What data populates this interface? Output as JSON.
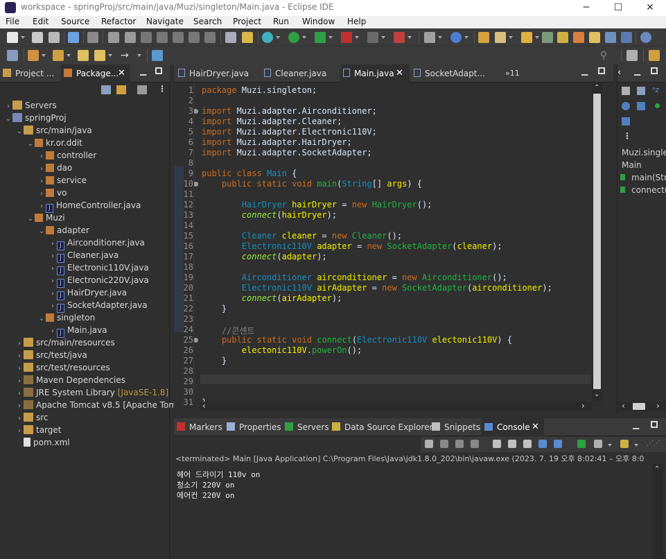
{
  "window": {
    "title": "workspace - springProj/src/main/java/Muzi/singleton/Main.java - Eclipse IDE"
  },
  "menu": [
    "File",
    "Edit",
    "Source",
    "Refactor",
    "Navigate",
    "Search",
    "Project",
    "Run",
    "Window",
    "Help"
  ],
  "left_tabs": {
    "project_explorer": "Project ...",
    "package_explorer": "Package..."
  },
  "tree": [
    {
      "label": "Servers",
      "level": 0,
      "type": "folder"
    },
    {
      "label": "springProj",
      "level": 0,
      "type": "proj"
    },
    {
      "label": "src/main/java",
      "level": 1,
      "type": "folder"
    },
    {
      "label": "kr.or.ddit",
      "level": 2,
      "type": "pkg"
    },
    {
      "label": "controller",
      "level": 3,
      "type": "pkg"
    },
    {
      "label": "dao",
      "level": 3,
      "type": "pkg"
    },
    {
      "label": "service",
      "level": 3,
      "type": "pkg"
    },
    {
      "label": "vo",
      "level": 3,
      "type": "pkg"
    },
    {
      "label": "HomeController.java",
      "level": 3,
      "type": "java"
    },
    {
      "label": "Muzi",
      "level": 2,
      "type": "pkg"
    },
    {
      "label": "adapter",
      "level": 3,
      "type": "pkg"
    },
    {
      "label": "Airconditioner.java",
      "level": 4,
      "type": "java"
    },
    {
      "label": "Cleaner.java",
      "level": 4,
      "type": "java"
    },
    {
      "label": "Electronic110V.java",
      "level": 4,
      "type": "java"
    },
    {
      "label": "Electronic220V.java",
      "level": 4,
      "type": "java"
    },
    {
      "label": "HairDryer.java",
      "level": 4,
      "type": "java"
    },
    {
      "label": "SocketAdapter.java",
      "level": 4,
      "type": "java"
    },
    {
      "label": "singleton",
      "level": 3,
      "type": "pkg"
    },
    {
      "label": "Main.java",
      "level": 4,
      "type": "java"
    },
    {
      "label": "src/main/resources",
      "level": 1,
      "type": "folder"
    },
    {
      "label": "src/test/java",
      "level": 1,
      "type": "folder"
    },
    {
      "label": "src/test/resources",
      "level": 1,
      "type": "folder"
    },
    {
      "label": "Maven Dependencies",
      "level": 1,
      "type": "lib"
    },
    {
      "label": "JRE System Library",
      "level": 1,
      "type": "lib",
      "suffix": "[JavaSE-1.8]"
    },
    {
      "label": "Apache Tomcat v8.5 [Apache Tom",
      "level": 1,
      "type": "lib"
    },
    {
      "label": "src",
      "level": 1,
      "type": "folder"
    },
    {
      "label": "target",
      "level": 1,
      "type": "folder"
    },
    {
      "label": "pom.xml",
      "level": 1,
      "type": "xml"
    }
  ],
  "editor_tabs": [
    "HairDryer.java",
    "Cleaner.java",
    "Main.java",
    "SocketAdapt...",
    "»11"
  ],
  "code": [
    {
      "n": "1",
      "html": "<span class=\"kw\">package</span> Muzi.singleton;"
    },
    {
      "n": "2",
      "html": ""
    },
    {
      "n": "3",
      "html": "<span class=\"kw\">import</span> Muzi.adapter.Airconditioner;"
    },
    {
      "n": "4",
      "html": "<span class=\"kw\">import</span> Muzi.adapter.Cleaner;"
    },
    {
      "n": "5",
      "html": "<span class=\"kw\">import</span> Muzi.adapter.Electronic110V;"
    },
    {
      "n": "6",
      "html": "<span class=\"kw\">import</span> Muzi.adapter.HairDryer;"
    },
    {
      "n": "7",
      "html": "<span class=\"kw\">import</span> Muzi.adapter.SocketAdapter;"
    },
    {
      "n": "8",
      "html": ""
    },
    {
      "n": "9",
      "html": "<span class=\"kw\">public</span> <span class=\"kw\">class</span> <span class=\"cls\">Main</span> {"
    },
    {
      "n": "10",
      "html": "    <span class=\"kw\">public</span> <span class=\"kw\">static</span> <span class=\"kw\">void</span> <span class=\"mth\">main</span>(<span class=\"tp\">String</span>[] <span class=\"var\">args</span>) {"
    },
    {
      "n": "11",
      "html": ""
    },
    {
      "n": "12",
      "html": "        <span class=\"tp\">HairDryer</span> <span class=\"var\">hairDryer</span> = <span class=\"kw\">new</span> <span class=\"mth\">HairDryer</span>();"
    },
    {
      "n": "13",
      "html": "        <span class=\"it\">connect</span>(<span class=\"var\">hairDryer</span>);"
    },
    {
      "n": "14",
      "html": ""
    },
    {
      "n": "15",
      "html": "        <span class=\"tp\">Cleaner</span> <span class=\"var\">cleaner</span> = <span class=\"kw\">new</span> <span class=\"mth\">Cleaner</span>();"
    },
    {
      "n": "16",
      "html": "        <span class=\"tp\">Electronic110V</span> <span class=\"var\">adapter</span> = <span class=\"kw\">new</span> <span class=\"mth\">SocketAdapter</span>(<span class=\"var\">cleaner</span>);"
    },
    {
      "n": "17",
      "html": "        <span class=\"it\">connect</span>(<span class=\"var\">adapter</span>);"
    },
    {
      "n": "18",
      "html": ""
    },
    {
      "n": "19",
      "html": "        <span class=\"tp\">Airconditioner</span> <span class=\"var\">airconditioner</span> = <span class=\"kw\">new</span> <span class=\"mth\">Airconditioner</span>();"
    },
    {
      "n": "20",
      "html": "        <span class=\"tp\">Electronic110V</span> <span class=\"var\">airAdapter</span> = <span class=\"kw\">new</span> <span class=\"mth\">SocketAdapter</span>(<span class=\"var\">airconditioner</span>);"
    },
    {
      "n": "21",
      "html": "        <span class=\"it\">connect</span>(<span class=\"var\">airAdapter</span>);"
    },
    {
      "n": "22",
      "html": "    }"
    },
    {
      "n": "23",
      "html": ""
    },
    {
      "n": "24",
      "html": "    <span class=\"cm\">//콘센트</span>"
    },
    {
      "n": "25",
      "html": "    <span class=\"kw\">public</span> <span class=\"kw\">static</span> <span class=\"kw\">void</span> <span class=\"mth\">connect</span>(<span class=\"tp\">Electronic110V</span> <span class=\"var\">electonic110V</span>) {"
    },
    {
      "n": "26",
      "html": "        <span class=\"var\">electonic110V</span>.<span class=\"mth\">powerOn</span>();"
    },
    {
      "n": "27",
      "html": "    }"
    },
    {
      "n": "28",
      "html": ""
    },
    {
      "n": "29",
      "html": ""
    },
    {
      "n": "30",
      "html": ""
    },
    {
      "n": "31",
      "html": "}"
    }
  ],
  "outline": {
    "title1": "Muzi.single",
    "title2": "Main",
    "item1": "main(Str",
    "item2": "connect("
  },
  "bottom_tabs": [
    "Markers",
    "Properties",
    "Servers",
    "Data Source Explorer",
    "Snippets",
    "Console"
  ],
  "console": {
    "header": "<terminated> Main [Java Application] C:\\Program Files\\Java\\jdk1.8.0_202\\bin\\javaw.exe  (2023. 7. 19 오후 8:02:41 – 오후 8:0",
    "lines": [
      "헤어 드라이기 110v on",
      "청소기 220V on",
      "에어컨 220V on"
    ]
  },
  "colors": {
    "keyword": "#cc6c1d",
    "type": "#1290c3",
    "variable": "#f2f200",
    "method": "#1eb540",
    "comment": "#808080"
  }
}
